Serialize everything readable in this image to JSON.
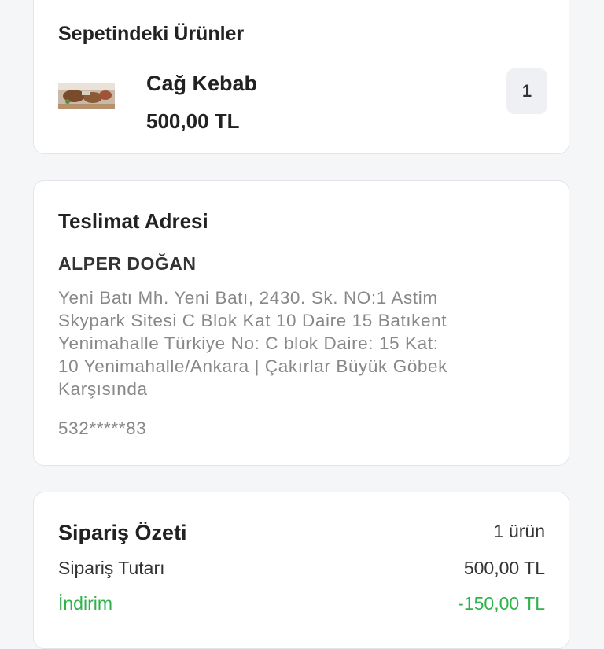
{
  "cart": {
    "title": "Sepetindeki Ürünler",
    "item": {
      "name": "Cağ Kebab",
      "price": "500,00 TL",
      "quantity": "1"
    }
  },
  "address": {
    "title": "Teslimat Adresi",
    "name": "ALPER DOĞAN",
    "lines": [
      "Yeni Batı Mh. Yeni Batı, 2430. Sk. NO:1 Astim",
      "Skypark Sitesi C Blok Kat 10 Daire 15 Batıkent",
      "Yenimahalle Türkiye No: C blok Daire: 15 Kat:",
      "10 Yenimahalle/Ankara | Çakırlar Büyük Göbek",
      "Karşısında"
    ],
    "phone": "532*****83"
  },
  "summary": {
    "title": "Sipariş Özeti",
    "count": "1 ürün",
    "order_total_label": "Sipariş Tutarı",
    "order_total_value": "500,00 TL",
    "discount_label": "İndirim",
    "discount_value": "-150,00 TL"
  },
  "colors": {
    "discount_green": "#2eb24a",
    "card_border": "#e3e5e8"
  }
}
